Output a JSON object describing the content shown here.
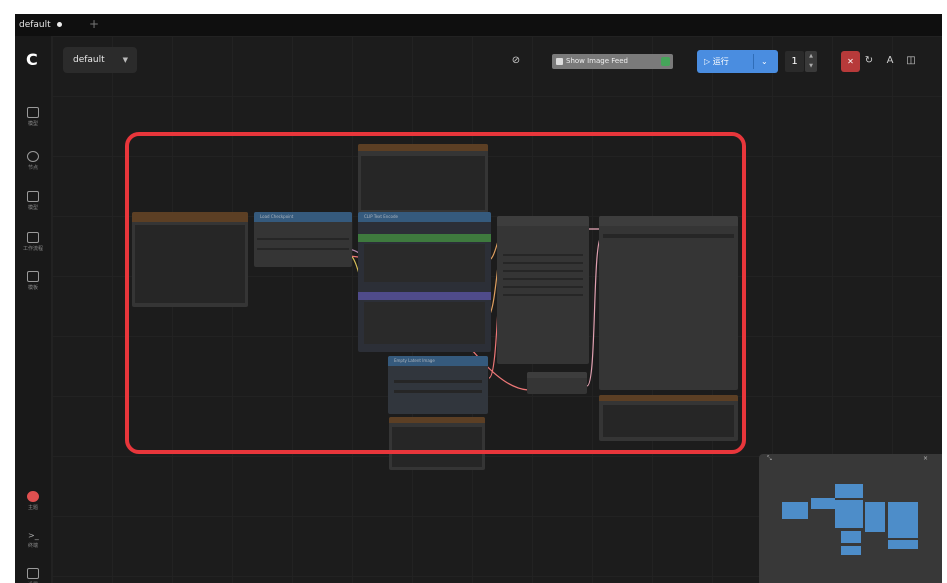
{
  "window": {
    "tab_title": "default",
    "new_tab": "+"
  },
  "toolbar": {
    "logo": "C",
    "workflow_select": "default",
    "show_image_feed": "Show Image Feed",
    "queue_label": "▷ 运行",
    "queue_dropdown": "⌄",
    "batch_count": "1",
    "stop_glyph": "✕",
    "icons": [
      "link-icon",
      "history-icon",
      "user-icon",
      "panel-icon"
    ]
  },
  "sidebar": {
    "top_items": [
      {
        "label": "模型",
        "icon": "image-icon"
      },
      {
        "label": "节点",
        "icon": "node-library-icon"
      },
      {
        "label": "模型",
        "icon": "model-library-icon"
      },
      {
        "label": "工作流程",
        "icon": "workflow-icon"
      },
      {
        "label": "模板",
        "icon": "templates-icon"
      }
    ],
    "bottom_items": [
      {
        "label": "主题",
        "icon": "theme-icon"
      },
      {
        "label": "终端",
        "icon": "terminal-icon"
      },
      {
        "label": "设置",
        "icon": "settings-icon"
      }
    ]
  },
  "graph": {
    "node_titles": [
      "Load Checkpoint",
      "CLIP Text Encode",
      "Empty Latent Image"
    ]
  },
  "minimap": {
    "close": "×"
  },
  "colors": {
    "highlight_border": "#e8363b",
    "queue_button": "#4a8de0",
    "stop_button": "#b73a3a",
    "minimap_node": "#4d8dc9"
  }
}
